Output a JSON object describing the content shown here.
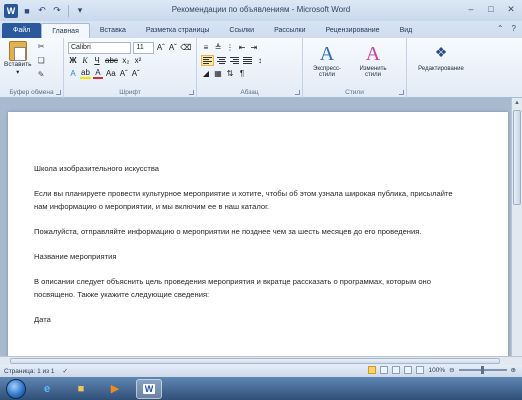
{
  "window": {
    "title": "Рекомендации по объявлениям - Microsoft Word",
    "app_icon": "W",
    "qat_icons": [
      "save-icon",
      "undo-icon",
      "redo-icon",
      "customize-icon"
    ]
  },
  "tabs": [
    {
      "label": "Файл",
      "kind": "file"
    },
    {
      "label": "Главная",
      "kind": "active"
    },
    {
      "label": "Вставка",
      "kind": "normal"
    },
    {
      "label": "Разметка страницы",
      "kind": "normal"
    },
    {
      "label": "Ссылки",
      "kind": "normal"
    },
    {
      "label": "Рассылки",
      "kind": "normal"
    },
    {
      "label": "Рецензирование",
      "kind": "normal"
    },
    {
      "label": "Вид",
      "kind": "normal"
    }
  ],
  "ribbon": {
    "clipboard": {
      "label": "Буфер обмена",
      "paste_label": "Вставить"
    },
    "font": {
      "label": "Шрифт",
      "font_name": "Calibri",
      "font_size": "11"
    },
    "paragraph": {
      "label": "Абзац"
    },
    "styles": {
      "label": "Стили",
      "express_label": "Экспресс-стили",
      "change_label": "Изменить стили"
    },
    "editing": {
      "label": "Редактирование"
    }
  },
  "document": {
    "paragraphs": [
      "Школа изобразительного искусства",
      "Если вы планируете провести культурное мероприятие и хотите, чтобы об этом узнала широкая публика, присылайте нам информацию о мероприятии, и мы включим ее в наш каталог.",
      "Пожалуйста, отправляйте информацию о мероприятии не позднее чем за шесть месяцев до его проведения.",
      "Название мероприятия",
      "В описании следует объяснить цель проведения мероприятия и вкратце рассказать о программах, которым оно посвящено. Также укажите следующие сведения:",
      "Дата"
    ]
  },
  "statusbar": {
    "page": "Страница: 1 из 1",
    "zoom": "100%"
  },
  "colors": {
    "file_tab": "#2a5a9c",
    "ribbon_bg": "#e2ebf6",
    "taskbar": "#2f4f78"
  }
}
